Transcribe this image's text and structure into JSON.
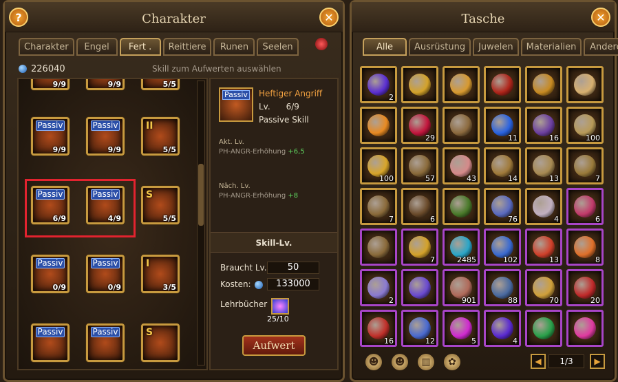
{
  "left_panel": {
    "title": "Charakter",
    "help_label": "?",
    "close_label": "✕",
    "tabs": [
      "Charakter",
      "Engel",
      "Fert .",
      "Reittiere",
      "Runen",
      "Seelen"
    ],
    "active_tab": "Fert .",
    "currency": "226040",
    "hint": "Skill zum Aufwerten auswählen",
    "skills": [
      {
        "badge": "",
        "level": "9/9"
      },
      {
        "badge": "",
        "level": "9/9"
      },
      {
        "badge": "",
        "level": "5/5"
      },
      {
        "badge": "Passiv",
        "level": "9/9"
      },
      {
        "badge": "Passiv",
        "level": "9/9"
      },
      {
        "badge": "II",
        "level": "5/5"
      },
      {
        "badge": "Passiv",
        "level": "6/9"
      },
      {
        "badge": "Passiv",
        "level": "4/9"
      },
      {
        "badge": "S",
        "level": "5/5"
      },
      {
        "badge": "Passiv",
        "level": "0/9"
      },
      {
        "badge": "Passiv",
        "level": "0/9"
      },
      {
        "badge": "I",
        "level": "3/5"
      },
      {
        "badge": "Passiv",
        "level": ""
      },
      {
        "badge": "Passiv",
        "level": ""
      },
      {
        "badge": "S",
        "level": ""
      }
    ],
    "detail": {
      "icon_badge": "Passiv",
      "name": "Heftiger Angriff",
      "lv_label": "Lv.",
      "lv_value": "6/9",
      "type": "Passive Skill",
      "current_label": "Akt. Lv.",
      "current_effect": "PH-ANGR-Erhöhung",
      "current_bonus": "+6,5",
      "next_label": "Näch. Lv.",
      "next_effect": "PH-ANGR-Erhöhung",
      "next_bonus": "+8",
      "section_header": "Skill-Lv.",
      "required_label": "Braucht Lv.:",
      "required_value": "50",
      "cost_label": "Kosten:",
      "cost_value": "133000",
      "books_label": "Lehrbücher",
      "books_count": "25/10",
      "upgrade_label": "Aufwert"
    }
  },
  "right_panel": {
    "title": "Tasche",
    "close_label": "✕",
    "tabs": [
      "Alle",
      "Ausrüstung",
      "Juwelen",
      "Materialien",
      "Andere"
    ],
    "active_tab": "Alle",
    "items": [
      {
        "count": "2",
        "purple": false,
        "color": "#5b2fd1"
      },
      {
        "count": "",
        "purple": false,
        "color": "#d4a22a"
      },
      {
        "count": "",
        "purple": false,
        "color": "#d89a30"
      },
      {
        "count": "",
        "purple": false,
        "color": "#b0251a"
      },
      {
        "count": "",
        "purple": false,
        "color": "#c78a22"
      },
      {
        "count": "",
        "purple": false,
        "color": "#d8b070"
      },
      {
        "count": "",
        "purple": false,
        "color": "#e88a22"
      },
      {
        "count": "29",
        "purple": false,
        "color": "#c3163d"
      },
      {
        "count": "",
        "purple": false,
        "color": "#8c6a3e"
      },
      {
        "count": "11",
        "purple": false,
        "color": "#2a63e0"
      },
      {
        "count": "16",
        "purple": false,
        "color": "#6c3fa0"
      },
      {
        "count": "100",
        "purple": false,
        "color": "#b89a58"
      },
      {
        "count": "100",
        "purple": false,
        "color": "#d8a52a"
      },
      {
        "count": "57",
        "purple": false,
        "color": "#8a6a3a"
      },
      {
        "count": "43",
        "purple": false,
        "color": "#d58a8a"
      },
      {
        "count": "14",
        "purple": false,
        "color": "#a07a3a"
      },
      {
        "count": "13",
        "purple": false,
        "color": "#a88a52"
      },
      {
        "count": "7",
        "purple": false,
        "color": "#9a7a3a"
      },
      {
        "count": "7",
        "purple": false,
        "color": "#8a6a3a"
      },
      {
        "count": "6",
        "purple": false,
        "color": "#6a4a2a"
      },
      {
        "count": "",
        "purple": false,
        "color": "#4a7a2a"
      },
      {
        "count": "76",
        "purple": false,
        "color": "#5a6ac0"
      },
      {
        "count": "4",
        "purple": false,
        "color": "#c2b0c0"
      },
      {
        "count": "6",
        "purple": true,
        "color": "#c23a6a"
      },
      {
        "count": "",
        "purple": true,
        "color": "#8a6a3a"
      },
      {
        "count": "7",
        "purple": true,
        "color": "#d4a22a"
      },
      {
        "count": "2485",
        "purple": true,
        "color": "#2aa6c8"
      },
      {
        "count": "102",
        "purple": true,
        "color": "#3a6ad0"
      },
      {
        "count": "13",
        "purple": true,
        "color": "#d0402a"
      },
      {
        "count": "8",
        "purple": true,
        "color": "#e0702a"
      },
      {
        "count": "2",
        "purple": true,
        "color": "#8a7ad0"
      },
      {
        "count": "",
        "purple": true,
        "color": "#6a4ad0"
      },
      {
        "count": "901",
        "purple": true,
        "color": "#b06a5a"
      },
      {
        "count": "88",
        "purple": true,
        "color": "#4a6aa0"
      },
      {
        "count": "70",
        "purple": true,
        "color": "#d0a03a"
      },
      {
        "count": "20",
        "purple": true,
        "color": "#c02a2a"
      },
      {
        "count": "16",
        "purple": true,
        "color": "#c0302a"
      },
      {
        "count": "12",
        "purple": true,
        "color": "#4a6ad0"
      },
      {
        "count": "5",
        "purple": true,
        "color": "#d02ad0"
      },
      {
        "count": "4",
        "purple": true,
        "color": "#5a2ad0"
      },
      {
        "count": "",
        "purple": true,
        "color": "#2aa04a"
      },
      {
        "count": "",
        "purple": true,
        "color": "#e03aa0"
      }
    ],
    "tools": [
      "☻",
      "☻",
      "▥",
      "✿"
    ],
    "page": "1/3",
    "prev_label": "◀",
    "next_label": "▶"
  }
}
